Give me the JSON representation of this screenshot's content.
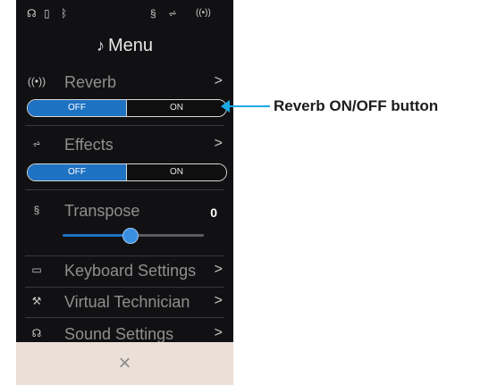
{
  "status_bar": {
    "icons": [
      "headphones-icon",
      "usb-icon",
      "bluetooth-icon",
      "transpose-icon",
      "effects-icon",
      "reverb-icon"
    ],
    "glyphs": [
      "☊",
      "▯",
      "ᛒ",
      "§",
      "⩫",
      "((•))"
    ]
  },
  "menu": {
    "title": "Menu",
    "items": [
      {
        "label": "Reverb",
        "icon": "((•))",
        "chevron": ">"
      },
      {
        "label": "Effects",
        "icon": "⩫",
        "chevron": ">"
      },
      {
        "label": "Transpose",
        "icon": "§",
        "value": "0"
      },
      {
        "label": "Keyboard Settings",
        "icon": "▭",
        "chevron": ">"
      },
      {
        "label": "Virtual Technician",
        "icon": "⚒",
        "chevron": ">"
      },
      {
        "label": "Sound Settings",
        "icon": "☊",
        "chevron": ">"
      }
    ],
    "reverb_toggle": {
      "off": "OFF",
      "on": "ON",
      "selected": "OFF"
    },
    "effects_toggle": {
      "off": "OFF",
      "on": "ON",
      "selected": "OFF"
    },
    "transpose_slider": {
      "value": 0
    }
  },
  "close_glyph": "×",
  "annotation": {
    "text": "Reverb ON/OFF button"
  },
  "colors": {
    "accent": "#1e72c2",
    "background": "#111113",
    "callout": "#19a9e6",
    "close_bar": "#eae0d8"
  }
}
